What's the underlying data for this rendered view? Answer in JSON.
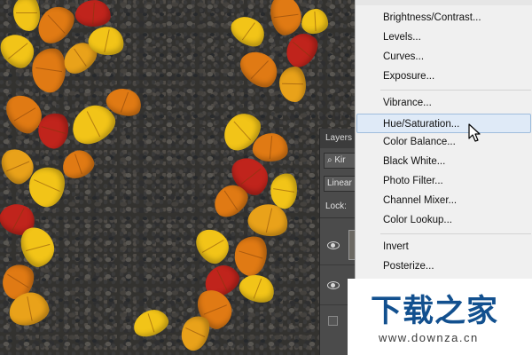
{
  "layers_panel": {
    "tab_label": "Layers",
    "kind_filter": "Kir",
    "blend_mode": "Linear",
    "lock_label": "Lock:"
  },
  "adjustments_menu": {
    "items": [
      {
        "label": "Brightness/Contrast..."
      },
      {
        "label": "Levels..."
      },
      {
        "label": "Curves..."
      },
      {
        "label": "Exposure..."
      },
      {
        "label": "Vibrance..."
      },
      {
        "label": "Hue/Saturation..."
      },
      {
        "label": "Color Balance..."
      },
      {
        "label": "Black  White..."
      },
      {
        "label": "Photo Filter..."
      },
      {
        "label": "Channel Mixer..."
      },
      {
        "label": "Color Lookup..."
      },
      {
        "label": "Invert"
      },
      {
        "label": "Posterize..."
      }
    ],
    "highlighted": "Hue/Saturation..."
  },
  "watermark": {
    "logo_text": "下载之家",
    "url": "www.downza.cn",
    "color": "#12508f"
  },
  "colors": {
    "leaf_yellow": "#f2c418",
    "leaf_orange": "#e07a14",
    "leaf_red": "#c0241c",
    "menu_bg": "#f0f0f0",
    "highlight": "#dfeaf7"
  }
}
